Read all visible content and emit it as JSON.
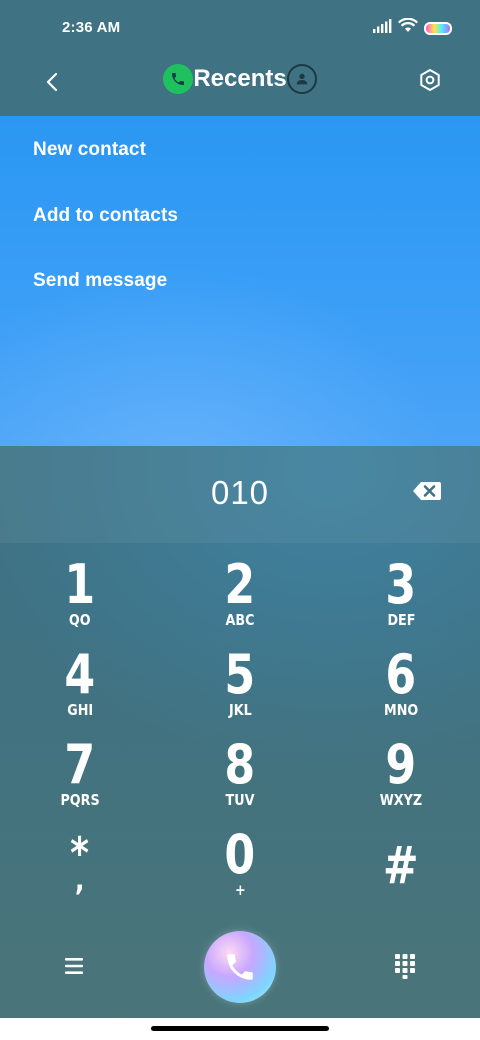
{
  "status_bar": {
    "time": "2:36 AM",
    "icons": [
      "signal-icon",
      "wifi-icon",
      "battery-icon"
    ]
  },
  "header": {
    "title": "Recents",
    "icons": [
      "back-arrow-icon",
      "phone-icon",
      "contacts-icon",
      "settings-icon"
    ],
    "colors": {
      "phone_badge": "#1fc15f"
    }
  },
  "menu": {
    "items": [
      {
        "label": "New contact"
      },
      {
        "label": "Add to contacts"
      },
      {
        "label": "Send message"
      }
    ],
    "colors": {
      "panel": "#2a97f2"
    }
  },
  "dialer": {
    "number": "010",
    "backspace_icon": "backspace-icon"
  },
  "keypad": {
    "keys": [
      {
        "digit": "1",
        "letters": "QO"
      },
      {
        "digit": "2",
        "letters": "ABC"
      },
      {
        "digit": "3",
        "letters": "DEF"
      },
      {
        "digit": "4",
        "letters": "GHI"
      },
      {
        "digit": "5",
        "letters": "JKL"
      },
      {
        "digit": "6",
        "letters": "MNO"
      },
      {
        "digit": "7",
        "letters": "PQRS"
      },
      {
        "digit": "8",
        "letters": "TUV"
      },
      {
        "digit": "9",
        "letters": "WXYZ"
      },
      {
        "digit": "*",
        "letters": ","
      },
      {
        "digit": "0",
        "letters": "+"
      },
      {
        "digit": "#",
        "letters": ""
      }
    ]
  },
  "bottom_bar": {
    "icons": [
      "menu-icon",
      "call-icon",
      "dialpad-icon"
    ]
  }
}
